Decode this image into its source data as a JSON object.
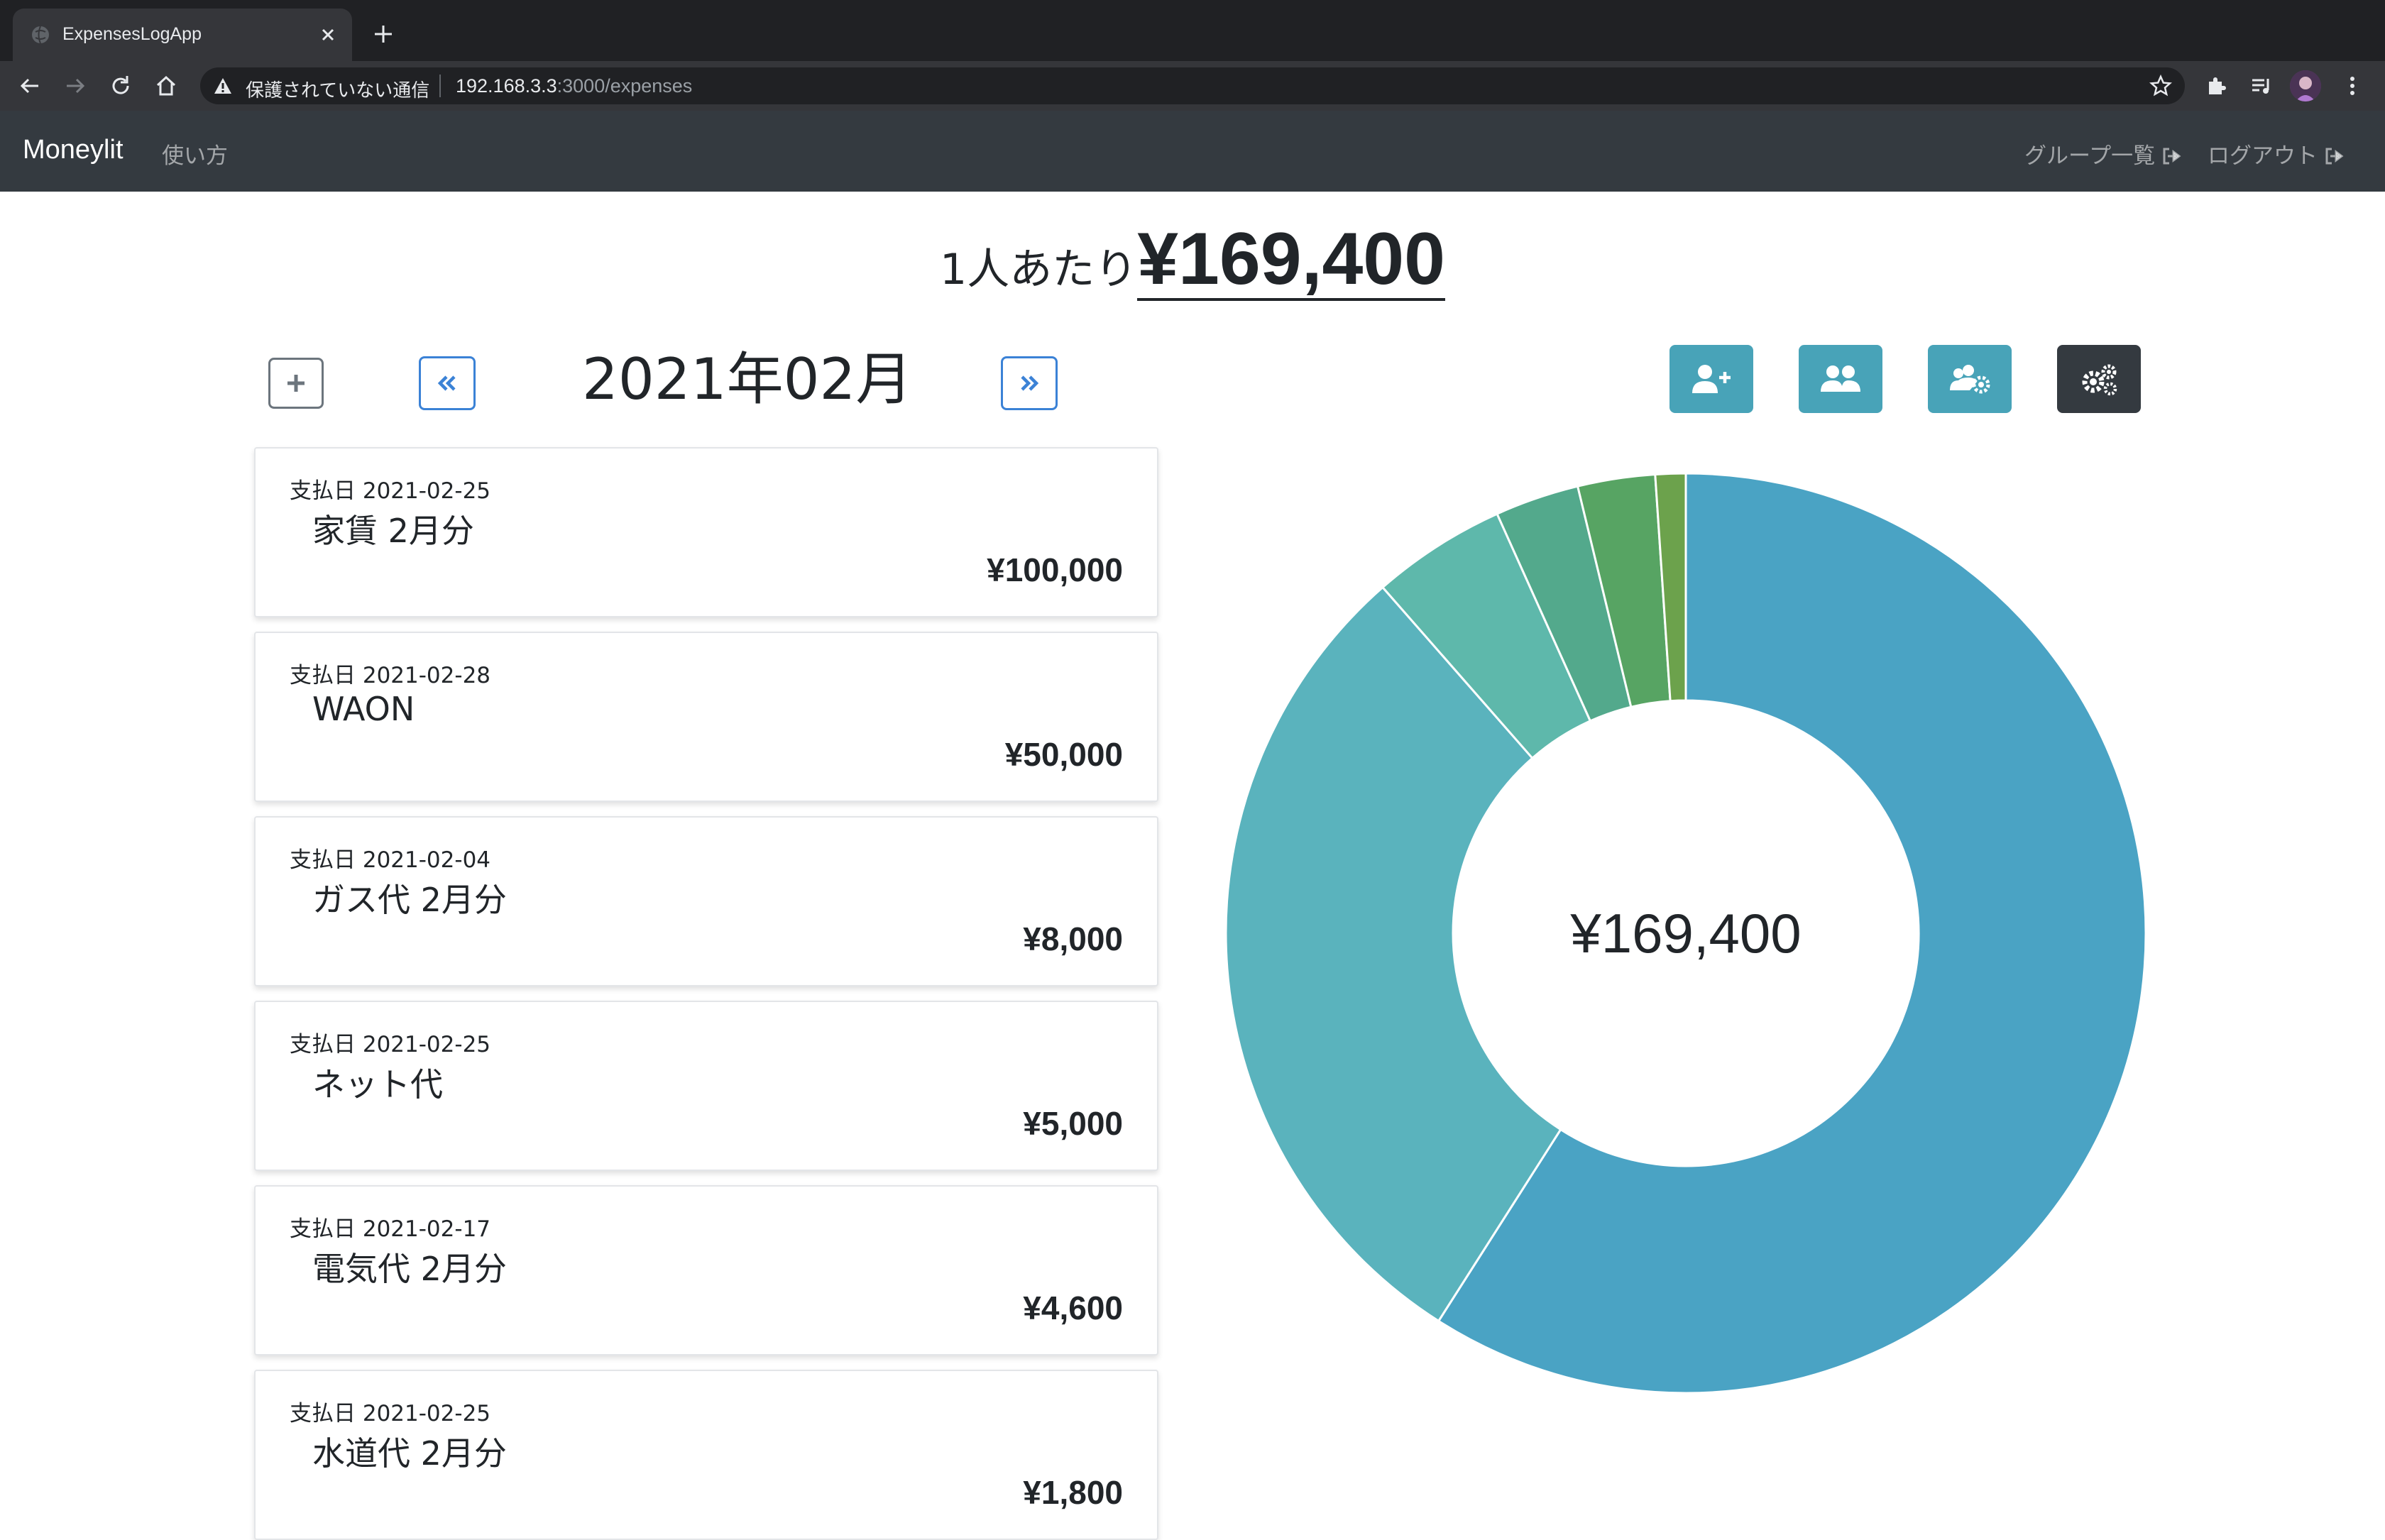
{
  "browser": {
    "tab_title": "ExpensesLogApp",
    "security_label": "保護されていない通信",
    "url_host": "192.168.3.3",
    "url_path": ":3000/expenses"
  },
  "nav": {
    "brand": "Moneylit",
    "howto": "使い方",
    "groups": "グループ一覧",
    "logout": "ログアウト"
  },
  "summary": {
    "per_person_label": "1人あたり",
    "per_person_amount": "¥169,400",
    "month": "2021年02月",
    "total": "¥169,400"
  },
  "expenses": [
    {
      "date_label": "支払日 2021-02-25",
      "name": "家賃 2月分",
      "amount": "¥100,000"
    },
    {
      "date_label": "支払日 2021-02-28",
      "name": "WAON",
      "amount": "¥50,000"
    },
    {
      "date_label": "支払日 2021-02-04",
      "name": "ガス代 2月分",
      "amount": "¥8,000"
    },
    {
      "date_label": "支払日 2021-02-25",
      "name": "ネット代",
      "amount": "¥5,000"
    },
    {
      "date_label": "支払日 2021-02-17",
      "name": "電気代 2月分",
      "amount": "¥4,600"
    },
    {
      "date_label": "支払日 2021-02-25",
      "name": "水道代 2月分",
      "amount": "¥1,800"
    }
  ],
  "chart_data": {
    "type": "pie",
    "donut": true,
    "categories": [
      "家賃 2月分",
      "WAON",
      "ガス代 2月分",
      "ネット代",
      "電気代 2月分",
      "水道代 2月分"
    ],
    "values": [
      100000,
      50000,
      8000,
      5000,
      4600,
      1800
    ],
    "colors": [
      "#4aa3c4",
      "#5ab3bd",
      "#5eb8ab",
      "#53a98c",
      "#57a463",
      "#6ca24c"
    ],
    "center_label": "¥169,400"
  },
  "colors": {
    "action_button": "#48a3b8",
    "settings_button": "#343a40",
    "navbar": "#343a40",
    "pager_border": "#3b82d6"
  },
  "icons": {
    "add": "plus-icon",
    "prev": "double-chevron-left-icon",
    "next": "double-chevron-right-icon",
    "actions": [
      "user-plus-icon",
      "users-icon",
      "users-cog-icon",
      "cogs-icon"
    ]
  }
}
